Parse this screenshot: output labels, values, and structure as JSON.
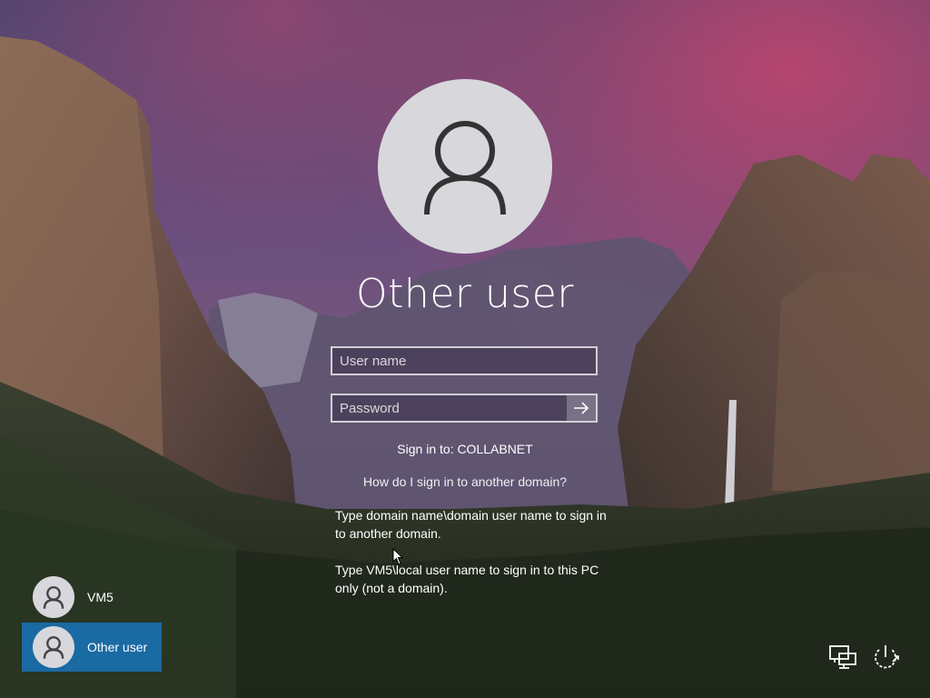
{
  "screen": {
    "current_user": "Other user",
    "avatar_icon": "user-icon"
  },
  "form": {
    "username_placeholder": "User name",
    "password_placeholder": "Password",
    "submit_icon": "arrow-right-icon",
    "sign_in_to": "Sign in to: COLLABNET",
    "help_link": "How do I sign in to another domain?",
    "hint_line1": "Type domain name\\domain user name to sign in to another domain.",
    "hint_line2": "Type VM5\\local user name to sign in to this PC only (not a domain)."
  },
  "users": [
    {
      "label": "VM5",
      "selected": false,
      "icon": "user-icon"
    },
    {
      "label": "Other user",
      "selected": true,
      "icon": "user-icon"
    }
  ],
  "corner": {
    "network_icon": "network-icon",
    "power_icon": "power-icon"
  },
  "colors": {
    "selected_tile": "#1a6aa3",
    "avatar_bg": "#d8d8dc"
  }
}
